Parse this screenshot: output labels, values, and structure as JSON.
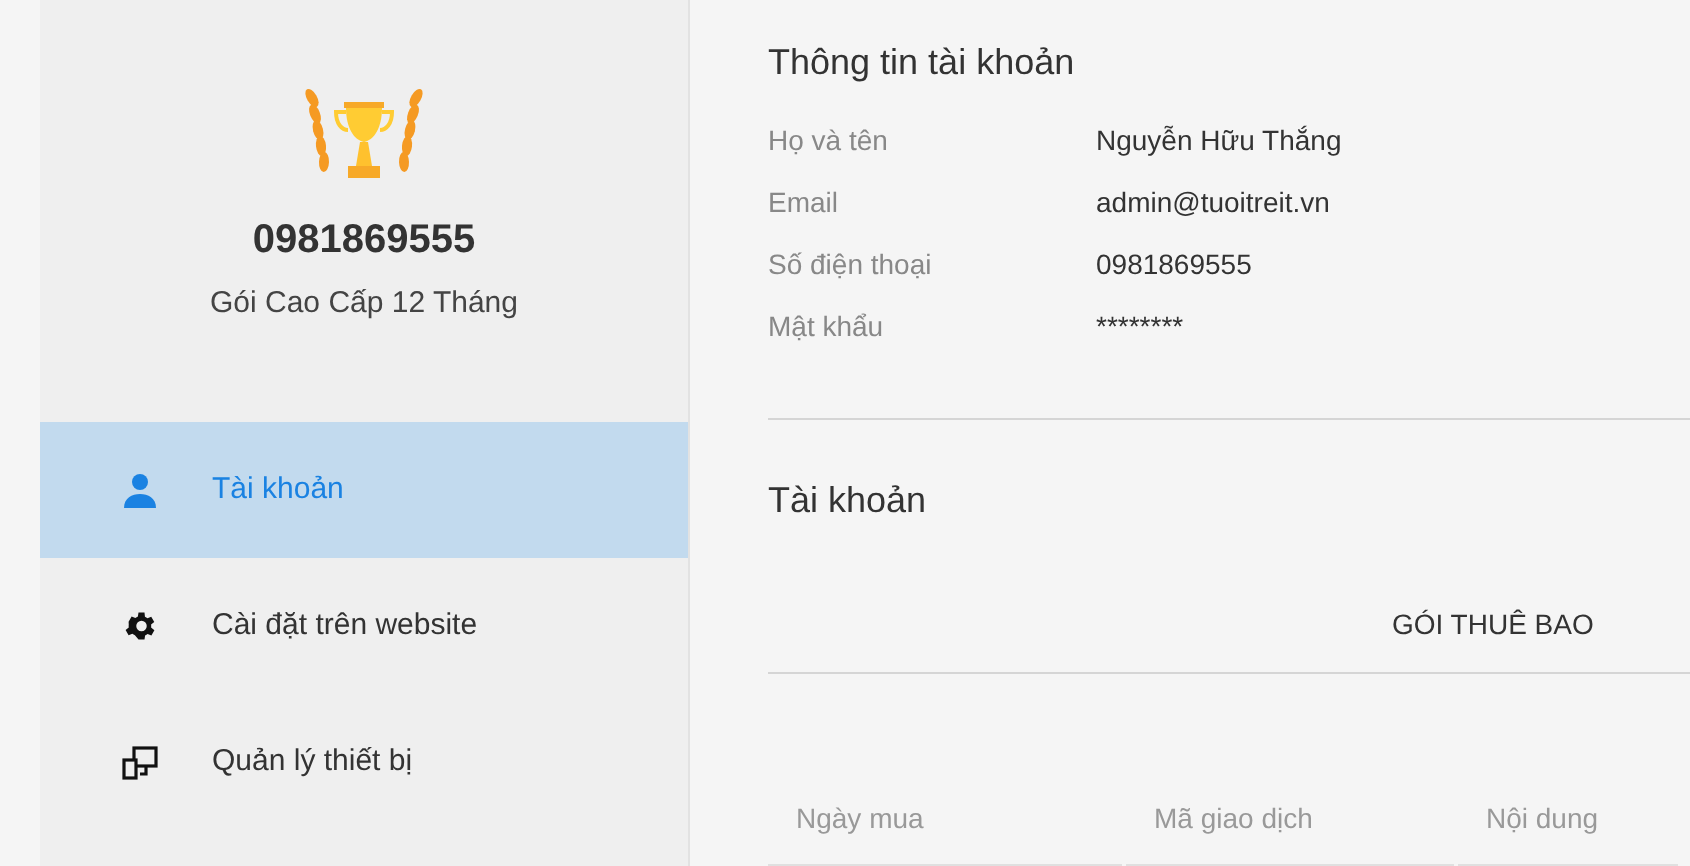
{
  "profile": {
    "phone": "0981869555",
    "plan": "Gói Cao Cấp 12 Tháng"
  },
  "sidebar": {
    "items": [
      {
        "label": "Tài khoản",
        "kind": "user",
        "selected": true
      },
      {
        "label": "Cài đặt trên website",
        "kind": "settings",
        "selected": false
      },
      {
        "label": "Quản lý thiết bị",
        "kind": "devices",
        "selected": false
      }
    ]
  },
  "account_info": {
    "title": "Thông tin tài khoản",
    "fields": [
      {
        "label": "Họ và tên",
        "value": "Nguyễn Hữu Thắng"
      },
      {
        "label": "Email",
        "value": "admin@tuoitreit.vn"
      },
      {
        "label": "Số điện thoại",
        "value": "0981869555"
      },
      {
        "label": "Mật khẩu",
        "value": "********"
      }
    ]
  },
  "account": {
    "title": "Tài khoản",
    "tab": "GÓI THUÊ BAO",
    "table": {
      "columns": [
        "Ngày mua",
        "Mã giao dịch",
        "Nội dung"
      ]
    }
  }
}
